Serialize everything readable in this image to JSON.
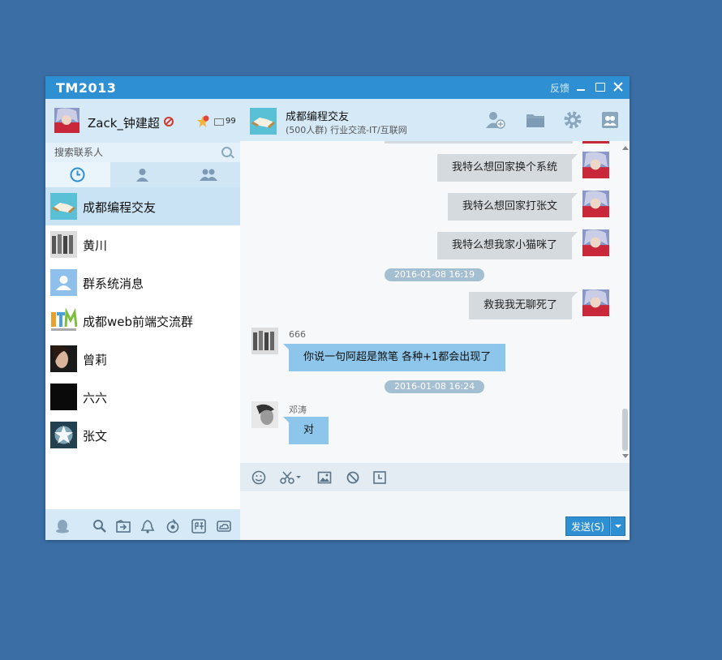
{
  "window": {
    "title": "TM2013",
    "feedback_label": "反馈"
  },
  "profile": {
    "username": "Zack_钟建超",
    "mail_count": "99",
    "status_icon": "busy-icon"
  },
  "search": {
    "placeholder": "搜索联系人"
  },
  "tabs": [
    {
      "icon": "clock-icon",
      "active": true
    },
    {
      "icon": "contact-icon",
      "active": false
    },
    {
      "icon": "group-icon",
      "active": false
    }
  ],
  "contacts": [
    {
      "name": "成都编程交友",
      "active": true
    },
    {
      "name": "黄川",
      "active": false
    },
    {
      "name": "群系统消息",
      "active": false
    },
    {
      "name": "成都web前端交流群",
      "active": false
    },
    {
      "name": "曾莉",
      "active": false
    },
    {
      "name": "六六",
      "active": false
    },
    {
      "name": "张文",
      "active": false
    }
  ],
  "chat": {
    "title": "成都编程交友",
    "subtitle": "(500人群) 行业交流-IT/互联网",
    "messages": [
      {
        "dir": "out",
        "text": "我特么想回家换个系统"
      },
      {
        "dir": "out",
        "text": "我特么想回家打张文"
      },
      {
        "dir": "out",
        "text": "我特么想我家小猫咪了"
      },
      {
        "dir": "time",
        "text": "2016-01-08 16:19"
      },
      {
        "dir": "out",
        "text": "救我我无聊死了"
      },
      {
        "dir": "in",
        "sender": "666",
        "text": "你说一句阿超是煞笔 各种+1都会出现了"
      },
      {
        "dir": "time",
        "text": "2016-01-08 16:24"
      },
      {
        "dir": "in",
        "sender": "邓涛",
        "text": "对"
      }
    ]
  },
  "send": {
    "label": "发送(S)"
  },
  "colors": {
    "accent": "#2f8fd3",
    "desktop": "#3a6ea5",
    "bubble_in": "#8dc6ea",
    "bubble_out": "#d5dadf"
  }
}
